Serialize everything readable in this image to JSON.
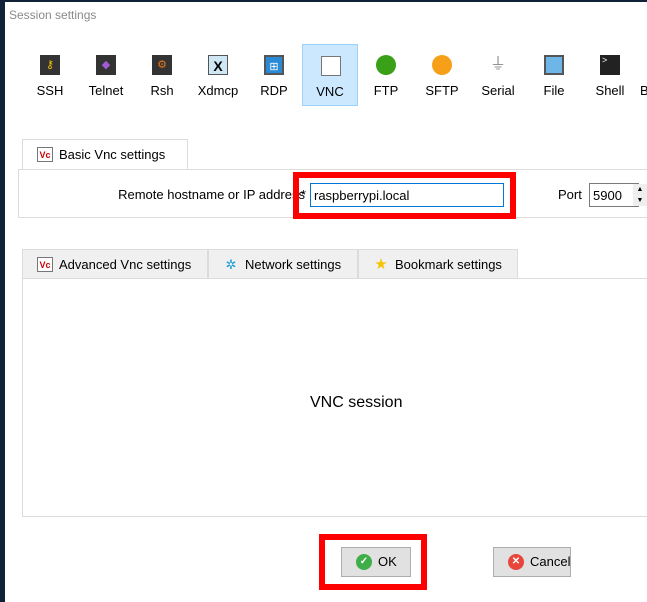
{
  "window": {
    "title": "Session settings"
  },
  "toolbar": {
    "items": [
      {
        "label": "SSH",
        "icon": "key-icon"
      },
      {
        "label": "Telnet",
        "icon": "gem-icon"
      },
      {
        "label": "Rsh",
        "icon": "gears-icon"
      },
      {
        "label": "Xdmcp",
        "icon": "x-monitor-icon"
      },
      {
        "label": "RDP",
        "icon": "windows-monitor-icon"
      },
      {
        "label": "VNC",
        "icon": "vnc-monitor-icon",
        "selected": true
      },
      {
        "label": "FTP",
        "icon": "green-globe-icon"
      },
      {
        "label": "SFTP",
        "icon": "orange-globe-icon"
      },
      {
        "label": "Serial",
        "icon": "plug-icon"
      },
      {
        "label": "File",
        "icon": "globe-monitor-icon"
      },
      {
        "label": "Shell",
        "icon": "terminal-icon"
      },
      {
        "label": "B",
        "icon": ""
      }
    ]
  },
  "basic": {
    "tab": "Basic Vnc settings",
    "host_label": "Remote hostname or IP address",
    "required": "*",
    "host_value": "raspberrypi.local",
    "port_label": "Port",
    "port_value": "5900"
  },
  "lower_tabs": [
    {
      "label": "Advanced Vnc settings"
    },
    {
      "label": "Network settings"
    },
    {
      "label": "Bookmark settings"
    }
  ],
  "content": {
    "text": "VNC session"
  },
  "buttons": {
    "ok": "OK",
    "cancel": "Cancel"
  },
  "colors": {
    "highlight": "#ff0000",
    "selected": "#cce8ff"
  }
}
